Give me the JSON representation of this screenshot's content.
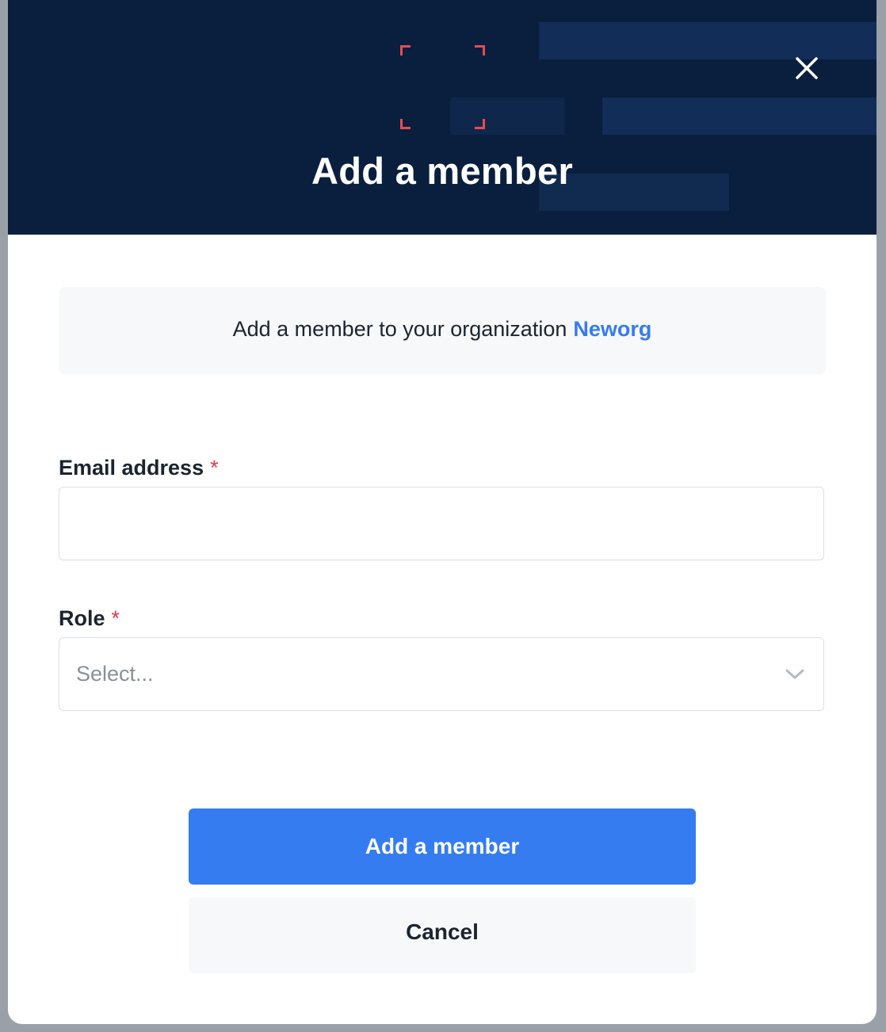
{
  "modal": {
    "title": "Add a member",
    "close_icon": "close-icon",
    "colors": {
      "header_bg": "#0a1f3d",
      "accent": "#357cf0",
      "bracket": "#e84a55",
      "required": "#e23b45"
    }
  },
  "info": {
    "text": "Add a member to your organization",
    "org_name": "Neworg"
  },
  "form": {
    "email": {
      "label": "Email address",
      "required_mark": "*",
      "value": ""
    },
    "role": {
      "label": "Role",
      "required_mark": "*",
      "placeholder": "Select...",
      "icon": "chevron-down-icon"
    }
  },
  "actions": {
    "submit_label": "Add a member",
    "cancel_label": "Cancel"
  }
}
